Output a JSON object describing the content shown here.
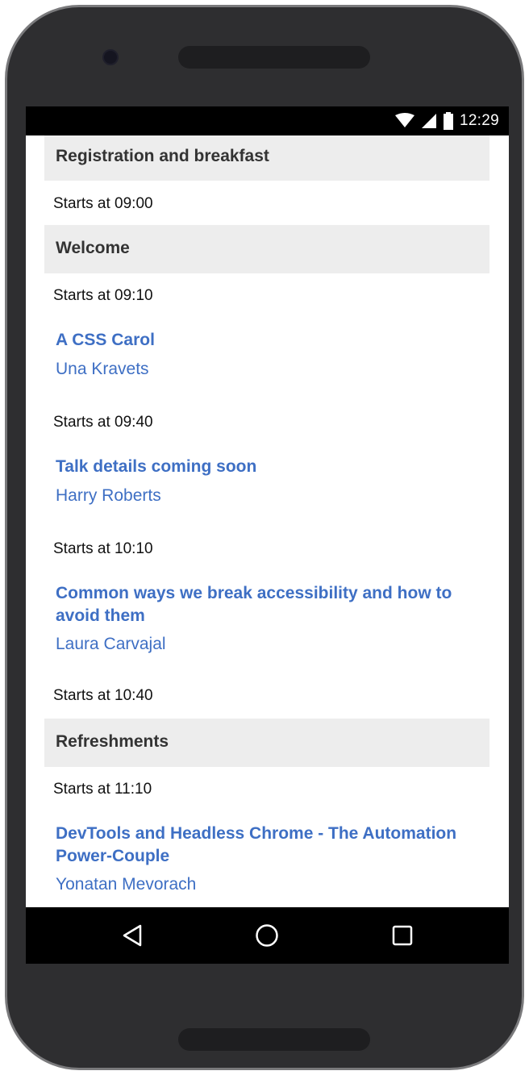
{
  "status_bar": {
    "time": "12:29",
    "icons": [
      "wifi-icon",
      "signal-icon",
      "battery-icon"
    ]
  },
  "schedule": [
    {
      "type": "section",
      "title": "Registration and breakfast"
    },
    {
      "type": "time",
      "text": "Starts at 09:00"
    },
    {
      "type": "section",
      "title": "Welcome"
    },
    {
      "type": "time",
      "text": "Starts at 09:10"
    },
    {
      "type": "talk",
      "title": "A CSS Carol",
      "speaker": "Una Kravets"
    },
    {
      "type": "time",
      "text": "Starts at 09:40"
    },
    {
      "type": "talk",
      "title": "Talk details coming soon",
      "speaker": "Harry Roberts"
    },
    {
      "type": "time",
      "text": "Starts at 10:10"
    },
    {
      "type": "talk",
      "title": "Common ways we break accessibility and how to avoid them",
      "speaker": "Laura Carvajal"
    },
    {
      "type": "time",
      "text": "Starts at 10:40"
    },
    {
      "type": "section",
      "title": "Refreshments"
    },
    {
      "type": "time",
      "text": "Starts at 11:10"
    },
    {
      "type": "talk",
      "title": "DevTools and Headless Chrome - The Automation Power-Couple",
      "speaker": "Yonatan Mevorach"
    }
  ],
  "nav_bar": {
    "buttons": [
      "back-icon",
      "home-icon",
      "recents-icon"
    ]
  },
  "colors": {
    "link": "#3e6fc4",
    "section_bg": "#ededed",
    "bezel": "#2e2e30"
  }
}
